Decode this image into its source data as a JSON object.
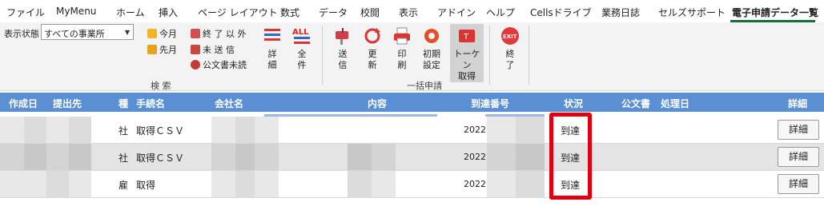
{
  "menu": {
    "items": [
      "ファイル",
      "MyMenu",
      "ホーム",
      "挿入",
      "ページ レイアウト",
      "数式",
      "データ",
      "校閲",
      "表示",
      "アドイン",
      "ヘルプ",
      "Cellsドライブ",
      "業務日誌",
      "セルズサポート",
      "電子申請データ一覧"
    ],
    "active": "電子申請データ一覧"
  },
  "ribbon": {
    "display_state_label": "表示状態",
    "display_state_value": "すべての事業所",
    "search_group": {
      "this_month": "今月",
      "last_month": "先月",
      "not_finished": "終 了 以 外",
      "unsent": "未 送 信",
      "official_unread": "公文書未読",
      "detail_line1": "詳",
      "detail_line2": "細",
      "all_line1": "全",
      "all_line2": "件",
      "label": "検 索"
    },
    "batch_group": {
      "send_line1": "送",
      "send_line2": "信",
      "update_line1": "更",
      "update_line2": "新",
      "print_line1": "印",
      "print_line2": "刷",
      "settings_line1": "初期",
      "settings_line2": "設定",
      "token_line1": "トーケン",
      "token_line2": "取得",
      "label": "一括申請"
    },
    "exit_line1": "終",
    "exit_line2": "了",
    "all_badge": "ALL",
    "exit_badge": "EXIT"
  },
  "table": {
    "headers": {
      "created": "作成日",
      "submit_to": "提出先",
      "kind": "種",
      "procedure": "手続名",
      "company": "会社名",
      "content": "内容",
      "arrival_no": "到達番号",
      "status": "状況",
      "official_doc": "公文書",
      "process_date": "処理日",
      "detail": "詳細"
    },
    "rows": [
      {
        "kind": "社",
        "procedure": "取得ＣＳＶ",
        "arrival_no": "2022",
        "status": "到達",
        "detail_button": "詳細"
      },
      {
        "kind": "社",
        "procedure": "取得ＣＳＶ",
        "arrival_no": "2022",
        "status": "到達",
        "detail_button": "詳細"
      },
      {
        "kind": "雇",
        "procedure": "取得",
        "arrival_no": "2022",
        "status": "到達",
        "detail_button": "詳細"
      }
    ]
  },
  "colors": {
    "header_bg": "#5b8fd4",
    "highlight": "#e00010",
    "active_tab_underline": "#1b6d3c"
  }
}
